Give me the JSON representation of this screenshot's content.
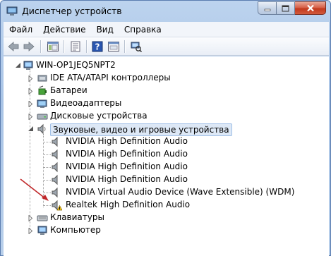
{
  "window": {
    "title": "Диспетчер устройств",
    "controls": {
      "minimize": "minimize",
      "maximize": "maximize",
      "close": "close"
    }
  },
  "menu": [
    "Файл",
    "Действие",
    "Вид",
    "Справка"
  ],
  "toolbar_icons": [
    "back-arrow-icon",
    "forward-arrow-icon",
    "show-hide-console-tree-icon",
    "properties-icon",
    "help-icon",
    "console-view-icon",
    "scan-hardware-icon"
  ],
  "tree": {
    "root": "WIN-OP1JEQ5NPT2",
    "categories": [
      {
        "label": "IDE ATA/ATAPI контроллеры",
        "icon": "ide-controller-icon",
        "expanded": false
      },
      {
        "label": "Батареи",
        "icon": "battery-icon",
        "expanded": false
      },
      {
        "label": "Видеоадаптеры",
        "icon": "display-adapter-icon",
        "expanded": false
      },
      {
        "label": "Дисковые устройства",
        "icon": "disk-drive-icon",
        "expanded": false
      },
      {
        "label": "Звуковые, видео и игровые устройства",
        "icon": "sound-device-icon",
        "expanded": true,
        "selected": true
      }
    ],
    "sound_children": [
      {
        "label": "NVIDIA High Definition Audio",
        "icon": "speaker-icon",
        "warning": false
      },
      {
        "label": "NVIDIA High Definition Audio",
        "icon": "speaker-icon",
        "warning": false
      },
      {
        "label": "NVIDIA High Definition Audio",
        "icon": "speaker-icon",
        "warning": false
      },
      {
        "label": "NVIDIA High Definition Audio",
        "icon": "speaker-icon",
        "warning": false
      },
      {
        "label": "NVIDIA Virtual Audio Device (Wave Extensible) (WDM)",
        "icon": "speaker-icon",
        "warning": false
      },
      {
        "label": "Realtek High Definition Audio",
        "icon": "speaker-warning-icon",
        "warning": true
      }
    ],
    "after": [
      {
        "label": "Клавиатуры",
        "icon": "keyboard-icon",
        "expanded": false
      },
      {
        "label": "Компьютер",
        "icon": "computer-icon",
        "expanded": false
      }
    ]
  },
  "colors": {
    "selection_bg": "#dde8f6",
    "selection_border": "#9fbfe6",
    "annotation_arrow": "#c0282a",
    "warning": "#f2c420"
  }
}
